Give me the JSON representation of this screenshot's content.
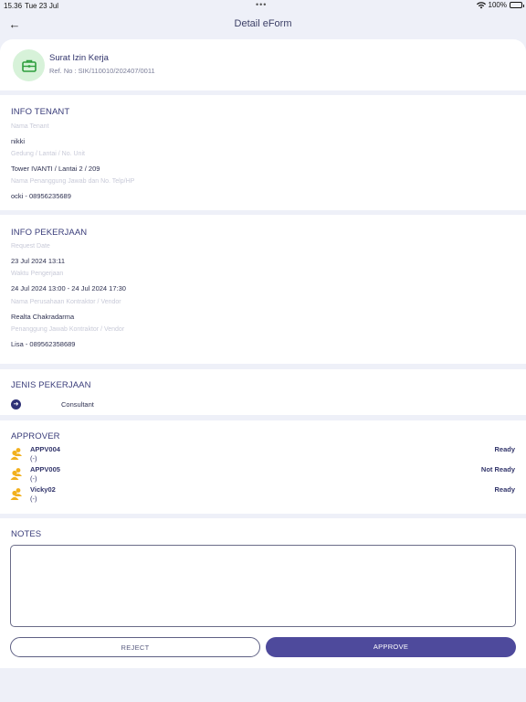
{
  "status_bar": {
    "time": "15.36",
    "date": "Tue 23 Jul",
    "battery": "100%"
  },
  "nav": {
    "title": "Detail eForm"
  },
  "form": {
    "title": "Surat Izin Kerja",
    "ref": "Ref. No : SIK/110010/202407/0011"
  },
  "info_tenant": {
    "title": "INFO TENANT",
    "fields": [
      {
        "label": "Nama Tenant",
        "value": "nikki"
      },
      {
        "label": "Gedung / Lantai / No. Unit",
        "value": "Tower IVANTI / Lantai 2 / 209"
      },
      {
        "label": "Nama Penanggung Jawab dan No. Telp/HP",
        "value": "ocki - 08956235689"
      }
    ]
  },
  "info_pekerjaan": {
    "title": "INFO PEKERJAAN",
    "fields": [
      {
        "label": "Request Date",
        "value": "23 Jul 2024 13:11"
      },
      {
        "label": "Waktu Pengerjaan",
        "value": "24 Jul 2024 13:00 - 24 Jul 2024 17:30"
      },
      {
        "label": "Nama Perusahaan Kontraktor / Vendor",
        "value": "Realta Chakradarma"
      },
      {
        "label": "Penanggung Jawab Kontraktor / Vendor",
        "value": "Lisa - 089562358689"
      }
    ]
  },
  "jenis_pekerjaan": {
    "title": "JENIS PEKERJAAN",
    "items": [
      "Consultant"
    ]
  },
  "approver": {
    "title": "APPROVER",
    "items": [
      {
        "name": "APPV004",
        "note": "(-)",
        "status": "Ready"
      },
      {
        "name": "APPV005",
        "note": "(-)",
        "status": "Not Ready"
      },
      {
        "name": "Vicky02",
        "note": "(-)",
        "status": "Ready"
      }
    ]
  },
  "notes": {
    "title": "NOTES",
    "value": ""
  },
  "actions": {
    "reject": "REJECT",
    "approve": "APPROVE"
  },
  "colors": {
    "primary": "#4e4a9c",
    "icon_bg": "#d7f2d9",
    "icon_green": "#2e9e3e",
    "approver_icon": "#f2b01e"
  }
}
